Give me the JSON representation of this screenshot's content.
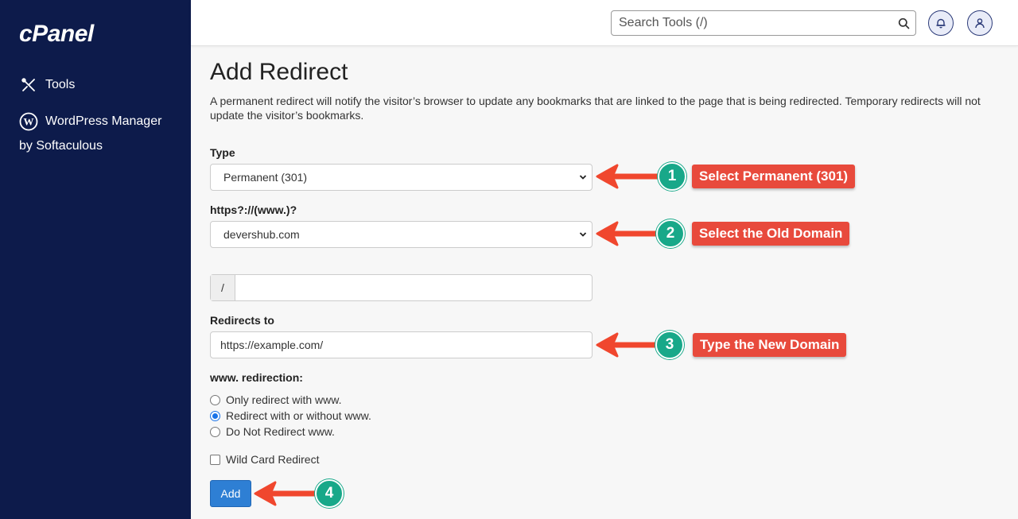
{
  "sidebar": {
    "logo": "cPanel",
    "items": [
      {
        "label": "Tools",
        "icon": "tools-icon"
      },
      {
        "label": "WordPress Manager",
        "label2": "by Softaculous",
        "icon": "wordpress-icon"
      }
    ],
    "bg_color": "#0d1b4b"
  },
  "header": {
    "search_placeholder": "Search Tools (/)"
  },
  "main": {
    "title": "Add Redirect",
    "description": "A permanent redirect will notify the visitor’s browser to update any bookmarks that are linked to the page that is being redirected. Temporary redirects will not update the visitor’s bookmarks.",
    "type_label": "Type",
    "type_value": "Permanent (301)",
    "domain_label": "https?://(www.)?",
    "domain_value": "devershub.com",
    "path_prefix": "/",
    "path_value": "",
    "redirects_to_label": "Redirects to",
    "redirects_to_value": "https://example.com/",
    "www_label": "www. redirection:",
    "www_options": [
      {
        "label": "Only redirect with www.",
        "checked": false
      },
      {
        "label": "Redirect with or without www.",
        "checked": true
      },
      {
        "label": "Do Not Redirect www.",
        "checked": false
      }
    ],
    "wildcard_label": "Wild Card Redirect",
    "wildcard_checked": false,
    "add_button": "Add"
  },
  "annotations": [
    {
      "step": "1",
      "text": "Select Permanent (301)"
    },
    {
      "step": "2",
      "text": "Select the Old Domain"
    },
    {
      "step": "3",
      "text": "Type the New Domain"
    },
    {
      "step": "4",
      "text": ""
    }
  ],
  "colors": {
    "accent": "#2e7fd4",
    "step_badge": "#18a889",
    "callout": "#e84a3c",
    "arrow": "#f0472e"
  }
}
